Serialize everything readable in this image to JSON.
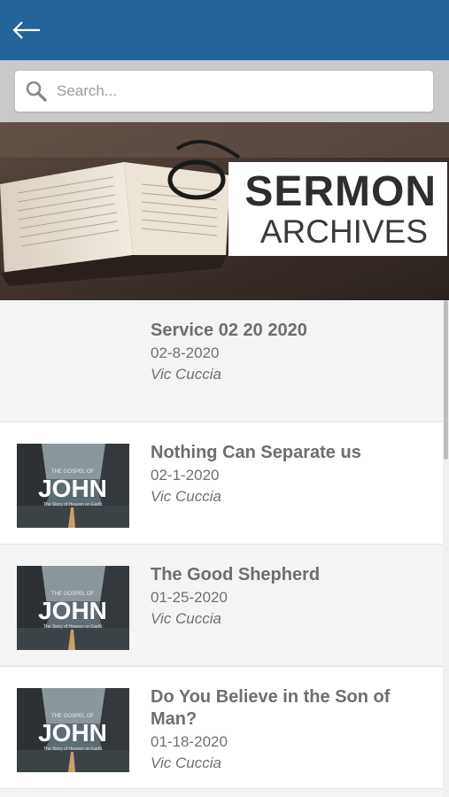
{
  "app": {
    "bar_color": "#23649b"
  },
  "header": {
    "back_icon": "arrow-left-icon"
  },
  "search": {
    "placeholder": "Search...",
    "icon": "search-icon"
  },
  "banner": {
    "title": "SERMON",
    "subtitle": "ARCHIVES"
  },
  "sermons": [
    {
      "title": "Service 02 20 2020",
      "date": "02-8-2020",
      "speaker": "Vic Cuccia",
      "has_thumbnail": false
    },
    {
      "title": "Nothing Can Separate us",
      "date": "02-1-2020",
      "speaker": "Vic Cuccia",
      "has_thumbnail": true
    },
    {
      "title": "The Good Shepherd",
      "date": "01-25-2020",
      "speaker": "Vic Cuccia",
      "has_thumbnail": true
    },
    {
      "title": "Do You Believe in the Son of Man?",
      "date": "01-18-2020",
      "speaker": "Vic Cuccia",
      "has_thumbnail": true
    }
  ],
  "thumbnail": {
    "kicker": "THE GOSPEL OF",
    "title": "JOHN",
    "tagline": "The Story of Heaven on Earth"
  }
}
